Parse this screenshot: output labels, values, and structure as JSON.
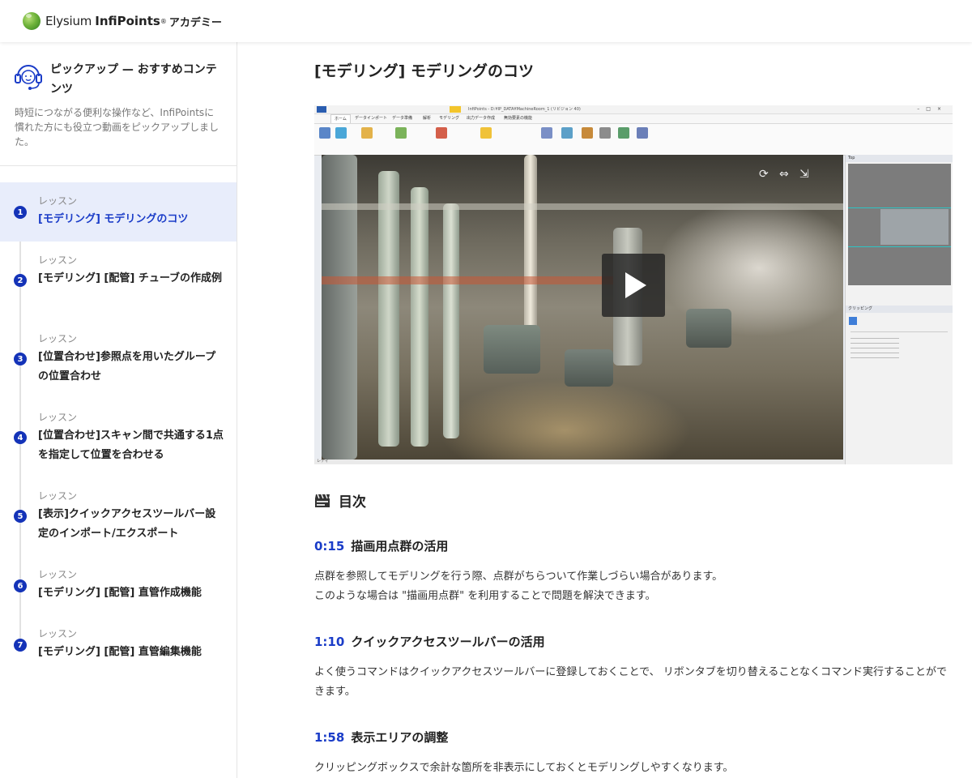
{
  "header": {
    "logo_name": "Elysium",
    "logo_brand": "InfiPoints",
    "logo_reg": "®",
    "logo_suffix": "アカデミー"
  },
  "sidebar": {
    "pickup_title": "ピックアップ — おすすめコンテンツ",
    "pickup_description": "時短につながる便利な操作など、InfiPointsに慣れた方にも役立つ動画をピックアップしました。",
    "lessons": [
      {
        "num": "1",
        "kind": "レッスン",
        "title": "[モデリング] モデリングのコツ",
        "active": true
      },
      {
        "num": "2",
        "kind": "レッスン",
        "title": "[モデリング] [配管] チューブの作成例",
        "active": false
      },
      {
        "num": "3",
        "kind": "レッスン",
        "title": "[位置合わせ]参照点を用いたグループの位置合わせ",
        "active": false
      },
      {
        "num": "4",
        "kind": "レッスン",
        "title": "[位置合わせ]スキャン間で共通する1点を指定して位置を合わせる",
        "active": false
      },
      {
        "num": "5",
        "kind": "レッスン",
        "title": "[表示]クイックアクセスツールバー設定のインポート/エクスポート",
        "active": false
      },
      {
        "num": "6",
        "kind": "レッスン",
        "title": "[モデリング] [配管] 直管作成機能",
        "active": false
      },
      {
        "num": "7",
        "kind": "レッスン",
        "title": "[モデリング] [配管] 直管編集機能",
        "active": false
      }
    ]
  },
  "main": {
    "title": "[モデリング] モデリングのコツ",
    "video": {
      "window_title": "InfiPoints - D:¥IP_DATA¥MachineRoom_1 (リビジョン 40)",
      "tabs": [
        "ホーム",
        "データインポート",
        "データ準備",
        "解析",
        "モデリング",
        "出力データ作成",
        "無効要素の機能"
      ],
      "side_panel_top": "Top",
      "side_panel_clip": "クリッピング",
      "status": "レディ"
    },
    "toc_title": "目次",
    "sections": [
      {
        "time": "0:15",
        "heading": "描画用点群の活用",
        "body_lines": [
          "点群を参照してモデリングを行う際、点群がちらついて作業しづらい場合があります。",
          "このような場合は \"描画用点群\" を利用することで問題を解決できます。"
        ]
      },
      {
        "time": "1:10",
        "heading": "クイックアクセスツールバーの活用",
        "body_lines": [
          "よく使うコマンドはクイックアクセスツールバーに登録しておくことで、 リボンタブを切り替えることなくコマンド実行することができます。"
        ]
      },
      {
        "time": "1:58",
        "heading": "表示エリアの調整",
        "body_lines": [
          "クリッピングボックスで余計な箇所を非表示にしておくとモデリングしやすくなります。"
        ]
      }
    ]
  },
  "colors": {
    "accent": "#1a3cc8",
    "step_badge": "#1433b8",
    "active_row": "#e8edfb"
  }
}
